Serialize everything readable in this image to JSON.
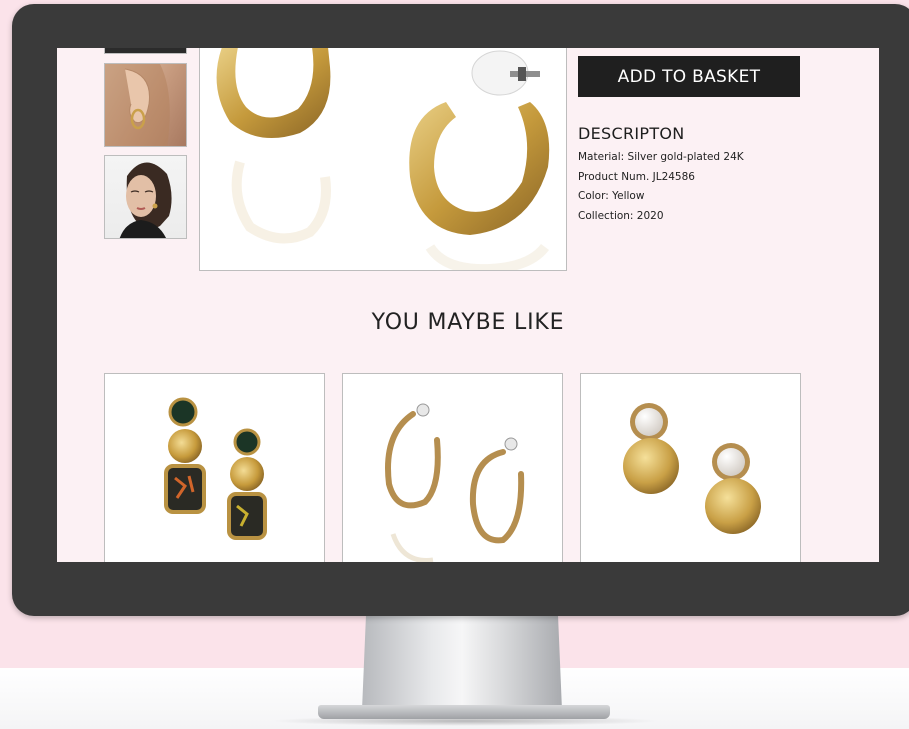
{
  "product": {
    "add_to_basket_label": "ADD TO BASKET",
    "description_title": "DESCRIPTON",
    "details": [
      "Material: Silver gold-plated 24K",
      "Product Num. JL24586",
      "Color: Yellow",
      "Collection: 2020"
    ],
    "thumbnails": [
      "model-partial",
      "ear-model",
      "face-model"
    ]
  },
  "recommendations": {
    "title": "YOU MAYBE LIKE",
    "items": [
      "gem-drop-earrings",
      "hoop-earrings",
      "pearl-stud-earrings"
    ]
  },
  "colors": {
    "accent_button": "#1f1f1f",
    "screen_background": "#fcf1f4",
    "page_background": "#fbe3ea",
    "gold": "#c9a24a"
  }
}
